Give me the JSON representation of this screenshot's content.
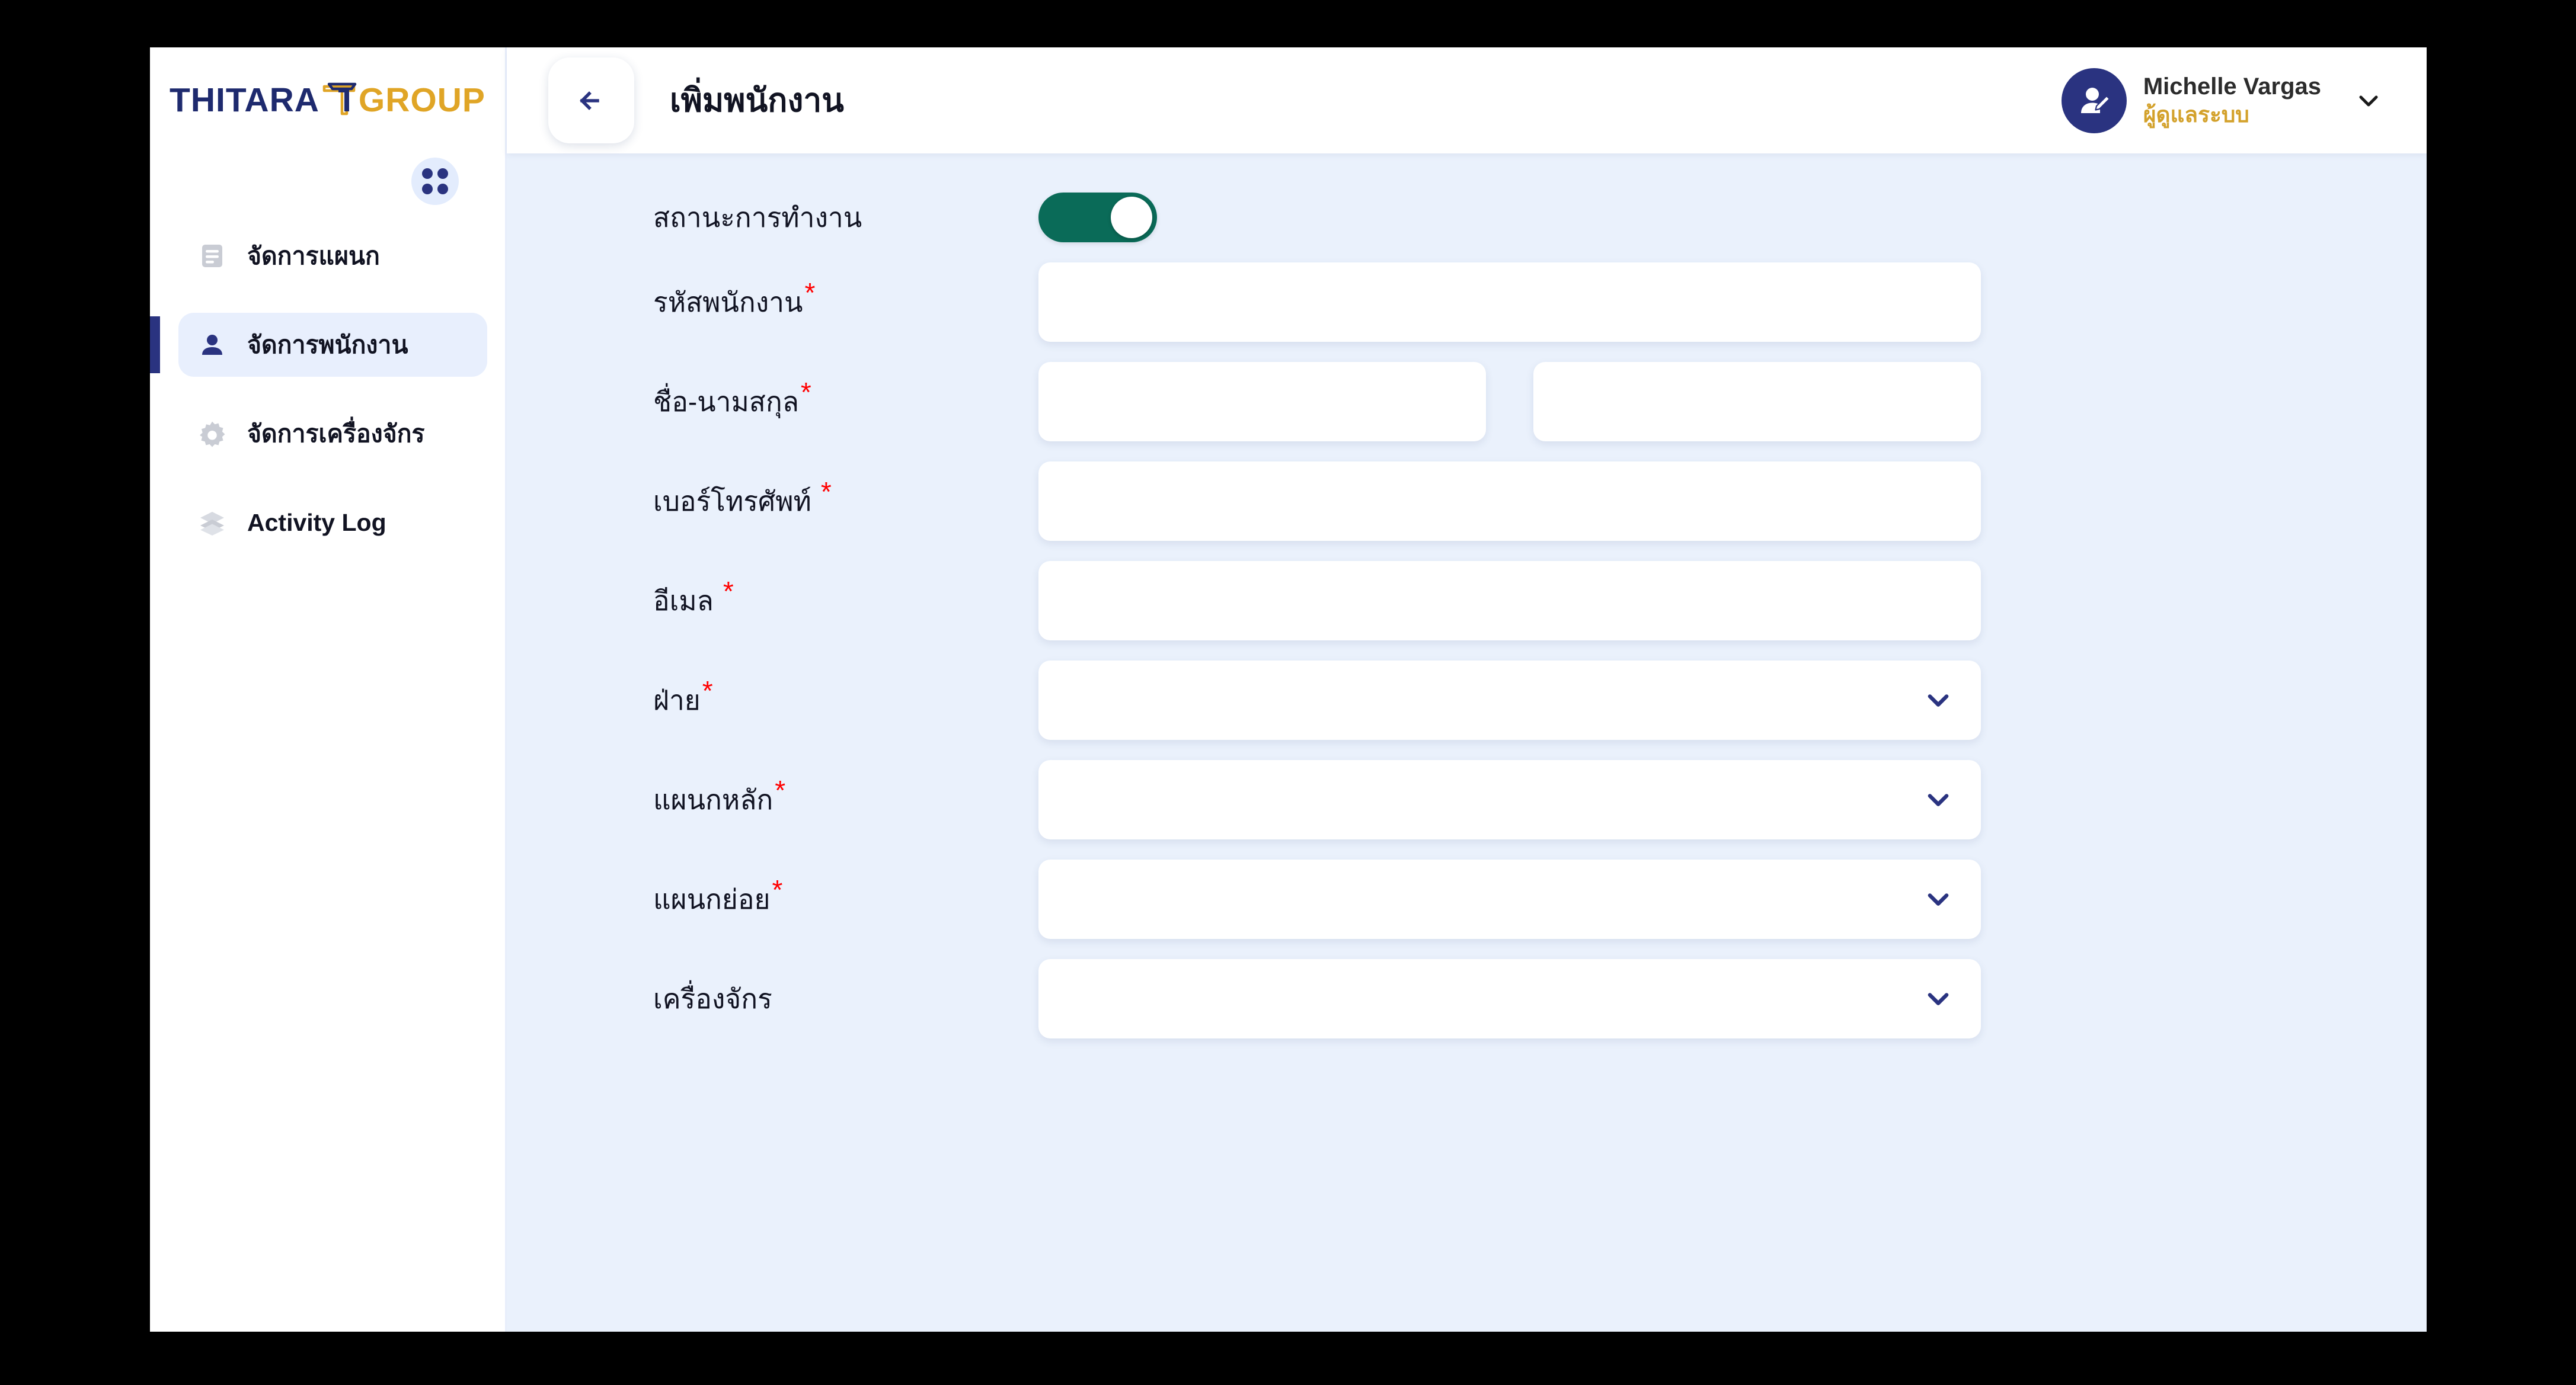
{
  "brand": {
    "name_primary": "THITARA",
    "name_secondary": "GROUP",
    "color_primary": "#1e2a6e",
    "color_secondary": "#e0a526"
  },
  "sidebar": {
    "apps_button_label": "apps",
    "items": [
      {
        "label": "จัดการแผนก",
        "icon": "document-icon",
        "active": false
      },
      {
        "label": "จัดการพนักงาน",
        "icon": "person-icon",
        "active": true
      },
      {
        "label": "จัดการเครื่องจักร",
        "icon": "gear-icon",
        "active": false
      },
      {
        "label": "Activity Log",
        "icon": "layers-icon",
        "active": false
      }
    ]
  },
  "topbar": {
    "back_label": "back",
    "title": "เพิ่มพนักงาน",
    "user": {
      "name": "Michelle Vargas",
      "role": "ผู้ดูแลระบบ",
      "role_color": "#d3a12b",
      "avatar_icon": "user-edit-icon",
      "caret_icon": "chevron-down-icon"
    }
  },
  "form": {
    "fields": [
      {
        "label": "สถานะการทำงาน",
        "required": false,
        "type": "toggle",
        "value": "on"
      },
      {
        "label": "รหัสพนักงาน",
        "required": true,
        "type": "text",
        "value": "",
        "placeholder": ""
      },
      {
        "label": "ชื่อ-นามสกุล",
        "required": true,
        "type": "text-split",
        "value_first": "",
        "value_last": "",
        "placeholder_first": "",
        "placeholder_last": ""
      },
      {
        "label": "เบอร์โทรศัพท์",
        "required": true,
        "required_gap": true,
        "type": "text",
        "value": "",
        "placeholder": ""
      },
      {
        "label": "อีเมล",
        "required": true,
        "required_gap": true,
        "type": "text",
        "value": "",
        "placeholder": ""
      },
      {
        "label": "ฝ่าย",
        "required": true,
        "type": "select",
        "value": "",
        "placeholder": ""
      },
      {
        "label": "แผนกหลัก",
        "required": true,
        "type": "select",
        "value": "",
        "placeholder": ""
      },
      {
        "label": "แผนกย่อย",
        "required": true,
        "type": "select",
        "value": "",
        "placeholder": ""
      },
      {
        "label": "เครื่องจักร",
        "required": false,
        "type": "select",
        "value": "",
        "placeholder": ""
      }
    ],
    "required_marker": "*"
  }
}
